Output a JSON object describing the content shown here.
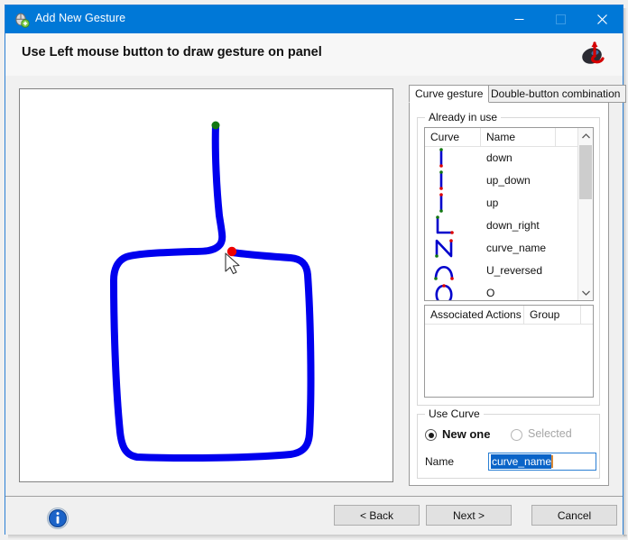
{
  "window": {
    "title": "Add New Gesture",
    "title_icon": "mouse-add-icon",
    "controls": {
      "minimize": "─",
      "maximize": "□",
      "close": "✕"
    }
  },
  "header": {
    "text": "Use Left mouse button to draw gesture on panel",
    "icon": "mouse-gesture-icon"
  },
  "canvas": {
    "name": "gesture-drawing-panel",
    "stroke_color": "#0000ee",
    "start_dot_color": "#008000",
    "end_dot_color": "#ee0000",
    "background": "#ffffff",
    "gesture": "line down then counter-clockwise square loop"
  },
  "tabs": [
    {
      "label": "Curve gesture",
      "active": true
    },
    {
      "label": "Double-button combination",
      "active": false
    }
  ],
  "already_in_use": {
    "title": "Already in use",
    "columns": [
      "Curve",
      "Name",
      ""
    ],
    "rows": [
      {
        "name": "down",
        "glyph": "down"
      },
      {
        "name": "up_down",
        "glyph": "up_down"
      },
      {
        "name": "up",
        "glyph": "up"
      },
      {
        "name": "down_right",
        "glyph": "down_right"
      },
      {
        "name": "curve_name",
        "glyph": "zigzag_n"
      },
      {
        "name": "U_reversed",
        "glyph": "arch"
      },
      {
        "name": "O",
        "glyph": "circle"
      }
    ],
    "scrollbar": {
      "up_arrow": "ⱏ",
      "down_arrow": "ⱝ"
    }
  },
  "associated_actions": {
    "columns": [
      "Associated Actions",
      "Group",
      ""
    ],
    "rows": []
  },
  "use_curve": {
    "title": "Use Curve",
    "options": [
      {
        "label": "New one",
        "checked": true,
        "disabled": false
      },
      {
        "label": "Selected",
        "checked": false,
        "disabled": true
      }
    ],
    "name_label": "Name",
    "name_value": "curve_name"
  },
  "footer": {
    "info_icon": "information-icon",
    "buttons": [
      {
        "label": "< Back"
      },
      {
        "label": "Next >"
      },
      {
        "label": "Cancel"
      }
    ]
  }
}
